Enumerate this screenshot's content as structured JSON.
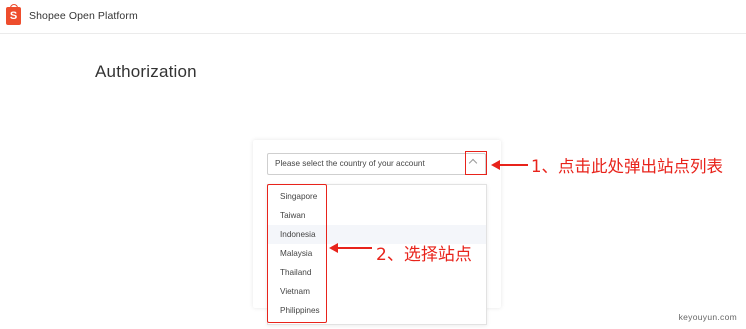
{
  "header": {
    "logo_letter": "S",
    "brand": "Shopee Open Platform"
  },
  "page": {
    "title": "Authorization"
  },
  "country_select": {
    "placeholder": "Please select the country of your account",
    "options": [
      "Singapore",
      "Taiwan",
      "Indonesia",
      "Malaysia",
      "Thailand",
      "Vietnam",
      "Philippines"
    ]
  },
  "annotations": {
    "note1": "1、点击此处弹出站点列表",
    "note2": "2、选择站点"
  },
  "watermark": "keyouyun.com",
  "colors": {
    "brand": "#ee4d2d",
    "annotation": "#e8231b"
  }
}
